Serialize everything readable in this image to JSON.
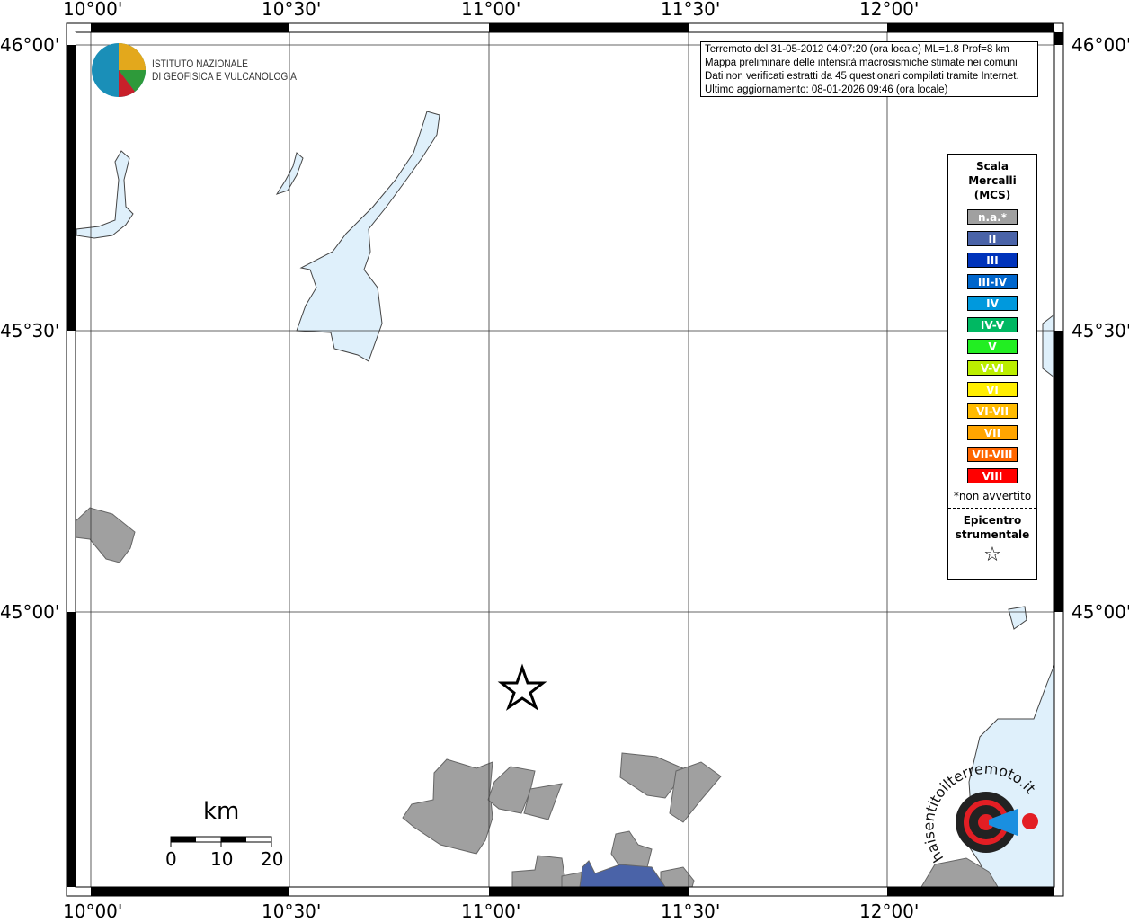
{
  "info": {
    "lines": [
      "Terremoto del 31-05-2012 04:07:20 (ora locale) ML=1.8 Prof=8 km",
      "Mappa preliminare delle intensità macrosismiche stimate nei comuni",
      "Dati non verificati estratti da 45 questionari compilati tramite Internet.",
      "Ultimo aggiornamento: 08-01-2026 09:46 (ora locale)"
    ]
  },
  "logo": {
    "line1": "ISTITUTO NAZIONALE",
    "line2": "DI GEOFISICA E VULCANOLOGIA"
  },
  "axes": {
    "lon": [
      "10°00'",
      "10°30'",
      "11°00'",
      "11°30'",
      "12°00'"
    ],
    "lat": [
      "46°00'",
      "45°30'",
      "45°00'"
    ]
  },
  "legend": {
    "title": [
      "Scala",
      "Mercalli",
      "(MCS)"
    ],
    "classes": [
      {
        "label": "n.a.*",
        "color": "#a0a0a0"
      },
      {
        "label": "II",
        "color": "#4a63a8"
      },
      {
        "label": "III",
        "color": "#0033bb"
      },
      {
        "label": "III-IV",
        "color": "#0066cc"
      },
      {
        "label": "IV",
        "color": "#0099dd"
      },
      {
        "label": "IV-V",
        "color": "#00b862"
      },
      {
        "label": "V",
        "color": "#22ee22"
      },
      {
        "label": "V-VI",
        "color": "#bbee00"
      },
      {
        "label": "VI",
        "color": "#ffee00"
      },
      {
        "label": "VI-VII",
        "color": "#ffbb00"
      },
      {
        "label": "VII",
        "color": "#ffa500"
      },
      {
        "label": "VII-VIII",
        "color": "#ff6600"
      },
      {
        "label": "VIII",
        "color": "#ff0000"
      }
    ],
    "note": "*non avvertito",
    "epicenter": [
      "Epicentro",
      "strumentale"
    ]
  },
  "scalebar": {
    "unit": "km",
    "ticks": [
      "0",
      "10",
      "20"
    ]
  },
  "watermark": "www.haisentitoilterremoto.it"
}
